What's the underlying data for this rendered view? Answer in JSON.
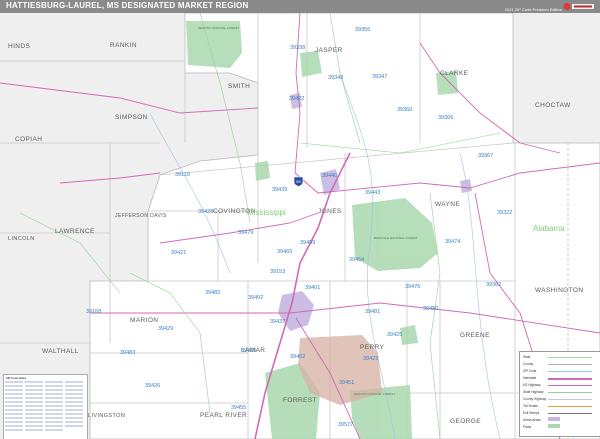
{
  "header": {
    "title": "HATTIESBURG-LAUREL, MS DESIGNATED MARKET REGION",
    "edition": "2021 ZIP Code Premium Edition"
  },
  "colors": {
    "title_bar": "#8a8a8a",
    "county_fill": "#ffffff",
    "outside_fill": "#efefef",
    "zip_text": "#3a7fc7",
    "highway": "#d06ab4",
    "park": "#a9d8ae",
    "urban": "#c5b6e0",
    "reservation": "#d8b4a8"
  },
  "counties": [
    "HINDS",
    "RANKIN",
    "SMITH",
    "JASPER",
    "CLARKE",
    "SIMPSON",
    "COPIAH",
    "CHOCTAW",
    "COVINGTON",
    "JONES",
    "WAYNE",
    "JEFFERSON DAVIS",
    "LAWRENCE",
    "LINCOLN",
    "MARION",
    "LAMAR",
    "PERRY",
    "GREENE",
    "WASHINGTON",
    "WALTHALL",
    "FORREST",
    "PEARL RIVER",
    "GEORGE",
    "LIVINGSTON"
  ],
  "states": [
    "Mississippi",
    "Alabama"
  ],
  "zip_codes": [
    "39356",
    "39338",
    "39348",
    "39347",
    "39422",
    "39360",
    "39366",
    "39119",
    "39439",
    "39443",
    "39367",
    "39322",
    "39428",
    "39479",
    "39421",
    "39464",
    "39476",
    "39362",
    "39482",
    "39402",
    "39401",
    "39429",
    "39475",
    "39425",
    "39451",
    "39423",
    "39483",
    "39426",
    "39455",
    "39577",
    "39462",
    "39481",
    "39168",
    "39153",
    "39437",
    "39440",
    "39459",
    "39465",
    "39474",
    "39480"
  ],
  "interstates": [
    "59"
  ],
  "parks": [
    "BIENVILLE NATIONAL FOREST",
    "DESOTO NATIONAL FOREST",
    "DESOTO NATIONAL FOREST"
  ],
  "legend": {
    "items": [
      "State",
      "County",
      "ZIP Code",
      "Interstate",
      "US Highway",
      "State Highway",
      "County Highway",
      "Toll Roads",
      "Exit Ramps",
      "Urban Areas",
      "Parks"
    ]
  },
  "compass": {
    "label": "N"
  },
  "zip_index_title": "ZIP Code Index"
}
